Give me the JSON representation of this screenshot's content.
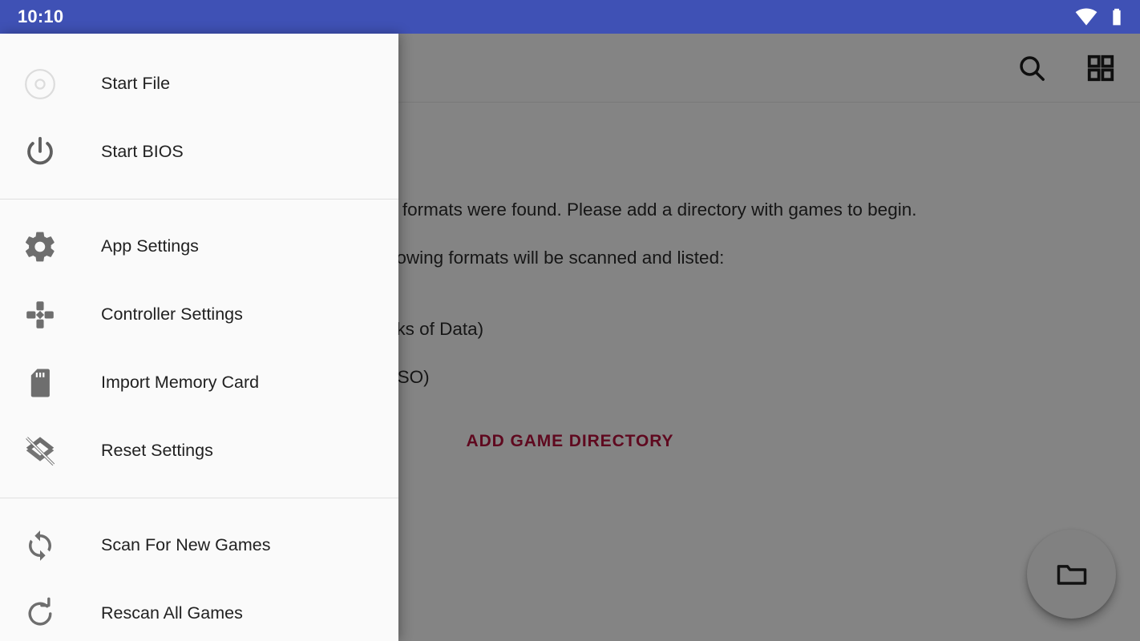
{
  "status_bar": {
    "clock": "10:10",
    "icons": [
      "wifi-icon",
      "battery-icon"
    ],
    "background_color": "#3f51b5"
  },
  "toolbar": {
    "actions": [
      {
        "name": "search-icon",
        "label": "Search"
      },
      {
        "name": "grid-view-icon",
        "label": "Grid View"
      }
    ]
  },
  "main": {
    "empty_message": "No games in supported formats were found. Please add a directory with games to begin.\n\nGame dumps in the following formats will be scanned and listed:\n\n.iso (ISO Disc Images)\n.chd (Compressed Hunks of Data)\n.cso (Compressed ISO)\n.zso (Zip Compressed ISO)",
    "add_directory_label": "ADD GAME DIRECTORY",
    "add_directory_color": "#b3123c",
    "fab": {
      "name": "folder-icon",
      "label": "Open Folder"
    }
  },
  "drawer": {
    "groups": [
      {
        "items": [
          {
            "label": "Start File",
            "icon": "disc-icon"
          },
          {
            "label": "Start BIOS",
            "icon": "power-icon"
          }
        ]
      },
      {
        "items": [
          {
            "label": "App Settings",
            "icon": "gear-icon"
          },
          {
            "label": "Controller Settings",
            "icon": "dpad-icon"
          },
          {
            "label": "Import Memory Card",
            "icon": "sd-card-icon"
          },
          {
            "label": "Reset Settings",
            "icon": "layers-clear-icon"
          }
        ]
      },
      {
        "items": [
          {
            "label": "Scan For New Games",
            "icon": "sync-icon"
          },
          {
            "label": "Rescan All Games",
            "icon": "refresh-icon"
          }
        ]
      }
    ]
  }
}
